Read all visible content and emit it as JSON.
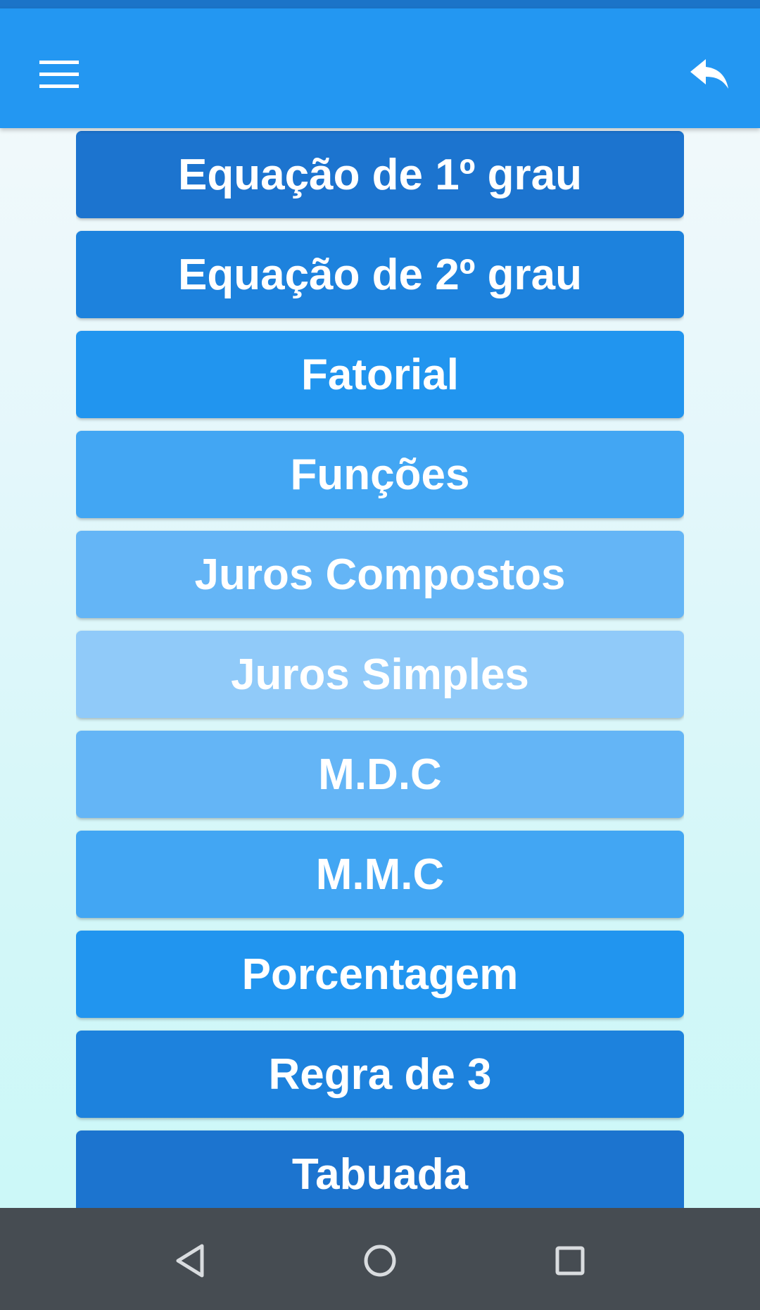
{
  "app_bar": {
    "menu_icon": "hamburger-menu-icon",
    "back_icon": "reply-arrow-icon",
    "background_color": "#2397f2"
  },
  "menu": {
    "items": [
      {
        "label": "Equação de 1º grau",
        "color": "#1c74cf"
      },
      {
        "label": "Equação de 2º grau",
        "color": "#1d82dd"
      },
      {
        "label": "Fatorial",
        "color": "#2195ef"
      },
      {
        "label": "Funções",
        "color": "#42a6f3"
      },
      {
        "label": "Juros Compostos",
        "color": "#64b5f6"
      },
      {
        "label": "Juros Simples",
        "color": "#90caf9"
      },
      {
        "label": "M.D.C",
        "color": "#64b5f6"
      },
      {
        "label": "M.M.C",
        "color": "#42a6f3"
      },
      {
        "label": "Porcentagem",
        "color": "#2195ef"
      },
      {
        "label": "Regra de 3",
        "color": "#1d82dd"
      },
      {
        "label": "Tabuada",
        "color": "#1c74cf"
      }
    ]
  },
  "nav_bar": {
    "back_icon": "nav-back-triangle-icon",
    "home_icon": "nav-home-circle-icon",
    "recents_icon": "nav-recents-square-icon",
    "background_color": "#464c52"
  }
}
